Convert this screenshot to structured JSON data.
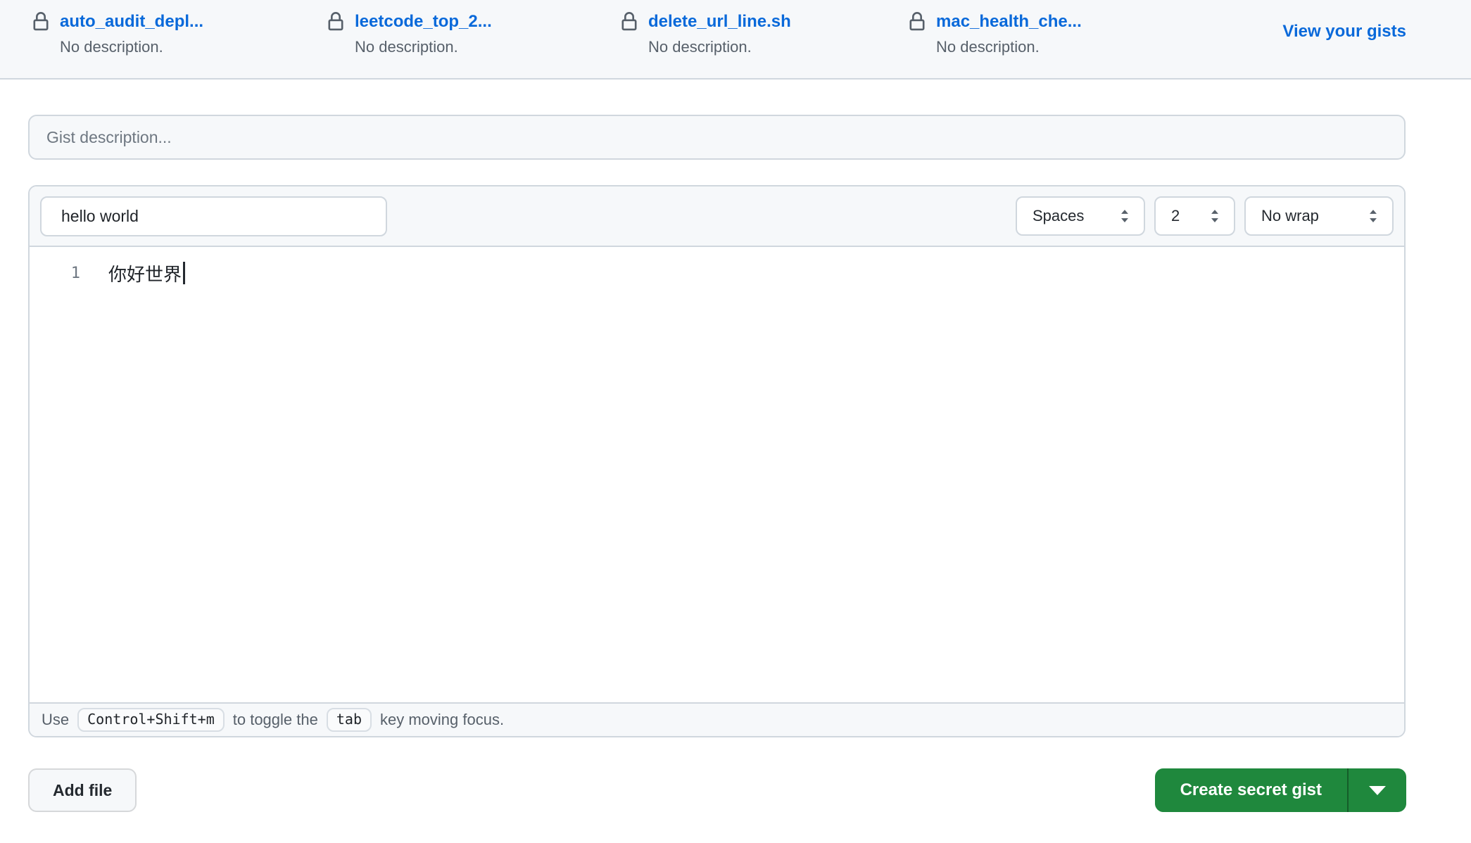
{
  "recent_gists": {
    "items": [
      {
        "name": "auto_audit_depl...",
        "description": "No description."
      },
      {
        "name": "leetcode_top_2...",
        "description": "No description."
      },
      {
        "name": "delete_url_line.sh",
        "description": "No description."
      },
      {
        "name": "mac_health_che...",
        "description": "No description."
      }
    ],
    "view_link": "View your gists"
  },
  "description_input": {
    "placeholder": "Gist description..."
  },
  "editor": {
    "filename": {
      "value": "hello world"
    },
    "controls": {
      "indent_mode": "Spaces",
      "indent_size": "2",
      "wrap_mode": "No wrap"
    },
    "code": {
      "lines": [
        {
          "number": "1",
          "text": "你好世界"
        }
      ]
    },
    "footer": {
      "prefix": "Use",
      "kbd1": "Control+Shift+m",
      "middle": "to toggle the",
      "kbd2": "tab",
      "suffix": "key moving focus."
    }
  },
  "actions": {
    "add_file": "Add file",
    "create": "Create secret gist"
  },
  "colors": {
    "accent_blue": "#0969da",
    "primary_green": "#1f883d",
    "muted_gray": "#57606a",
    "surface_gray": "#f6f8fa",
    "border_gray": "#d0d7de"
  }
}
